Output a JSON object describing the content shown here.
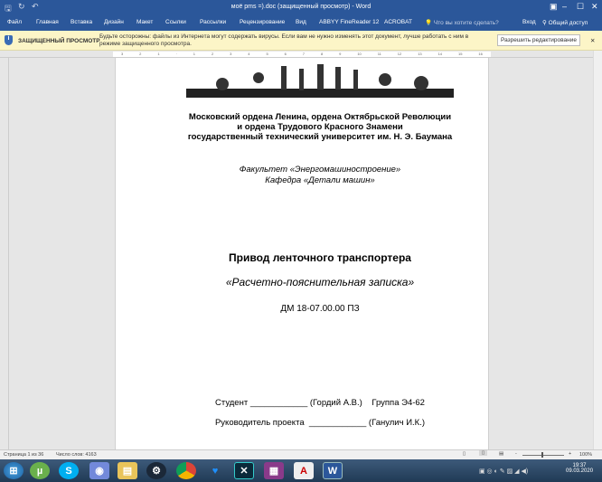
{
  "window": {
    "title": "моё pms =).doc (защищенный просмотр) - Word"
  },
  "ribbon": {
    "tabs": [
      "Файл",
      "Главная",
      "Вставка",
      "Дизайн",
      "Макет",
      "Ссылки",
      "Рассылки",
      "Рецензирование",
      "Вид",
      "ABBYY FineReader 12",
      "ACROBAT"
    ],
    "tell_me": "Что вы хотите сделать?",
    "signin": "Вход",
    "share": "Общий доступ"
  },
  "message_bar": {
    "title": "ЗАЩИЩЕННЫЙ ПРОСМОТР",
    "text": "Будьте осторожны: файлы из Интернета могут содержать вирусы. Если вам не нужно изменять этот документ, лучше работать с ним в режиме защищенного просмотра.",
    "enable_button": "Разрешить редактирование",
    "colors": {
      "bg": "#fcf5c7"
    }
  },
  "document": {
    "org_lines": [
      "Московский ордена Ленина, ордена Октябрьской Революции",
      "и ордена Трудового Красного Знамени",
      "государственный технический университет им. Н. Э. Баумана"
    ],
    "faculty": "Факультет «Энергомашиностроение»",
    "department": "Кафедра «Детали машин»",
    "title": "Привод ленточного транспортера",
    "subtitle": "«Расчетно-пояснительная записка»",
    "code": "ДМ 18-07.00.00 ПЗ",
    "student_line": "Студент ____________ (Гордий А.В.)    Группа Э4-62",
    "supervisor_line": "Руководитель проекта  ____________ (Ганулич И.К.)"
  },
  "status": {
    "page": "Страница 1 из 36",
    "words": "Число слов: 4163",
    "zoom": "100%"
  },
  "taskbar": {
    "time": "19:37",
    "date": "09.03.2020"
  },
  "colors": {
    "accent": "#2b579a"
  }
}
